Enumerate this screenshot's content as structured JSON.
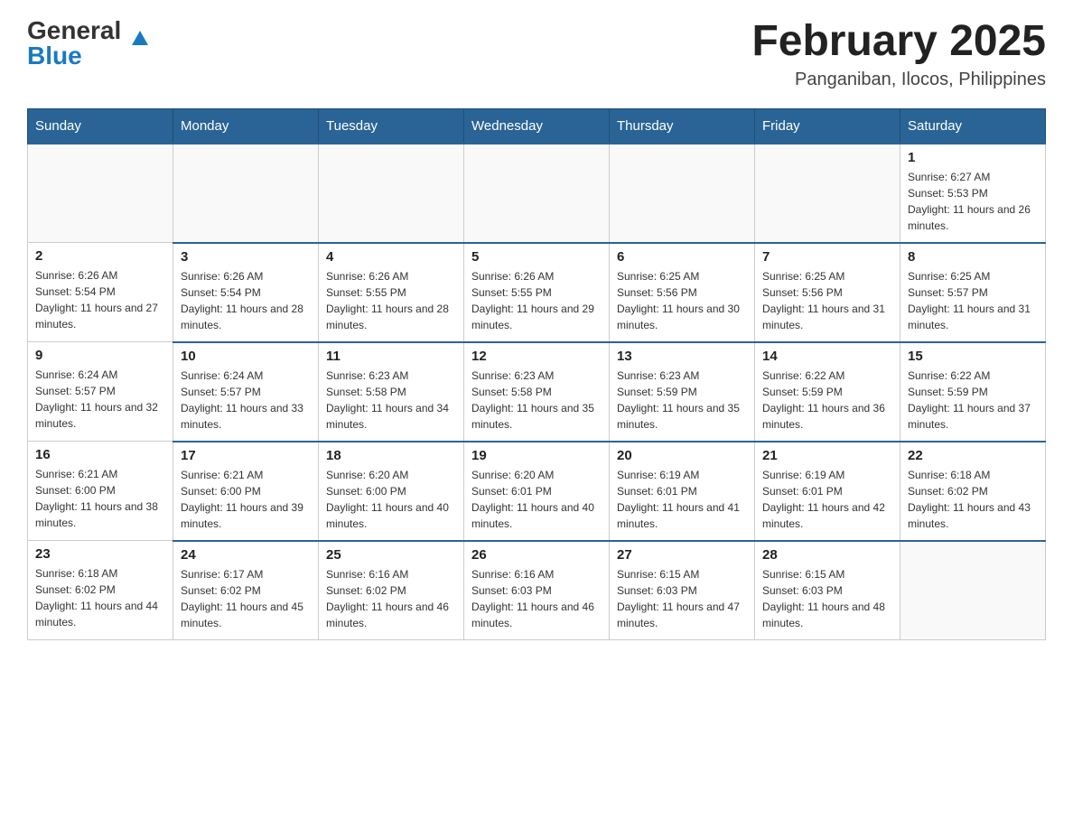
{
  "header": {
    "logo": {
      "general": "General",
      "blue": "Blue",
      "arrow": "▲"
    },
    "title": "February 2025",
    "location": "Panganiban, Ilocos, Philippines"
  },
  "days_of_week": [
    "Sunday",
    "Monday",
    "Tuesday",
    "Wednesday",
    "Thursday",
    "Friday",
    "Saturday"
  ],
  "weeks": [
    [
      {
        "day": "",
        "info": ""
      },
      {
        "day": "",
        "info": ""
      },
      {
        "day": "",
        "info": ""
      },
      {
        "day": "",
        "info": ""
      },
      {
        "day": "",
        "info": ""
      },
      {
        "day": "",
        "info": ""
      },
      {
        "day": "1",
        "info": "Sunrise: 6:27 AM\nSunset: 5:53 PM\nDaylight: 11 hours and 26 minutes."
      }
    ],
    [
      {
        "day": "2",
        "info": "Sunrise: 6:26 AM\nSunset: 5:54 PM\nDaylight: 11 hours and 27 minutes."
      },
      {
        "day": "3",
        "info": "Sunrise: 6:26 AM\nSunset: 5:54 PM\nDaylight: 11 hours and 28 minutes."
      },
      {
        "day": "4",
        "info": "Sunrise: 6:26 AM\nSunset: 5:55 PM\nDaylight: 11 hours and 28 minutes."
      },
      {
        "day": "5",
        "info": "Sunrise: 6:26 AM\nSunset: 5:55 PM\nDaylight: 11 hours and 29 minutes."
      },
      {
        "day": "6",
        "info": "Sunrise: 6:25 AM\nSunset: 5:56 PM\nDaylight: 11 hours and 30 minutes."
      },
      {
        "day": "7",
        "info": "Sunrise: 6:25 AM\nSunset: 5:56 PM\nDaylight: 11 hours and 31 minutes."
      },
      {
        "day": "8",
        "info": "Sunrise: 6:25 AM\nSunset: 5:57 PM\nDaylight: 11 hours and 31 minutes."
      }
    ],
    [
      {
        "day": "9",
        "info": "Sunrise: 6:24 AM\nSunset: 5:57 PM\nDaylight: 11 hours and 32 minutes."
      },
      {
        "day": "10",
        "info": "Sunrise: 6:24 AM\nSunset: 5:57 PM\nDaylight: 11 hours and 33 minutes."
      },
      {
        "day": "11",
        "info": "Sunrise: 6:23 AM\nSunset: 5:58 PM\nDaylight: 11 hours and 34 minutes."
      },
      {
        "day": "12",
        "info": "Sunrise: 6:23 AM\nSunset: 5:58 PM\nDaylight: 11 hours and 35 minutes."
      },
      {
        "day": "13",
        "info": "Sunrise: 6:23 AM\nSunset: 5:59 PM\nDaylight: 11 hours and 35 minutes."
      },
      {
        "day": "14",
        "info": "Sunrise: 6:22 AM\nSunset: 5:59 PM\nDaylight: 11 hours and 36 minutes."
      },
      {
        "day": "15",
        "info": "Sunrise: 6:22 AM\nSunset: 5:59 PM\nDaylight: 11 hours and 37 minutes."
      }
    ],
    [
      {
        "day": "16",
        "info": "Sunrise: 6:21 AM\nSunset: 6:00 PM\nDaylight: 11 hours and 38 minutes."
      },
      {
        "day": "17",
        "info": "Sunrise: 6:21 AM\nSunset: 6:00 PM\nDaylight: 11 hours and 39 minutes."
      },
      {
        "day": "18",
        "info": "Sunrise: 6:20 AM\nSunset: 6:00 PM\nDaylight: 11 hours and 40 minutes."
      },
      {
        "day": "19",
        "info": "Sunrise: 6:20 AM\nSunset: 6:01 PM\nDaylight: 11 hours and 40 minutes."
      },
      {
        "day": "20",
        "info": "Sunrise: 6:19 AM\nSunset: 6:01 PM\nDaylight: 11 hours and 41 minutes."
      },
      {
        "day": "21",
        "info": "Sunrise: 6:19 AM\nSunset: 6:01 PM\nDaylight: 11 hours and 42 minutes."
      },
      {
        "day": "22",
        "info": "Sunrise: 6:18 AM\nSunset: 6:02 PM\nDaylight: 11 hours and 43 minutes."
      }
    ],
    [
      {
        "day": "23",
        "info": "Sunrise: 6:18 AM\nSunset: 6:02 PM\nDaylight: 11 hours and 44 minutes."
      },
      {
        "day": "24",
        "info": "Sunrise: 6:17 AM\nSunset: 6:02 PM\nDaylight: 11 hours and 45 minutes."
      },
      {
        "day": "25",
        "info": "Sunrise: 6:16 AM\nSunset: 6:02 PM\nDaylight: 11 hours and 46 minutes."
      },
      {
        "day": "26",
        "info": "Sunrise: 6:16 AM\nSunset: 6:03 PM\nDaylight: 11 hours and 46 minutes."
      },
      {
        "day": "27",
        "info": "Sunrise: 6:15 AM\nSunset: 6:03 PM\nDaylight: 11 hours and 47 minutes."
      },
      {
        "day": "28",
        "info": "Sunrise: 6:15 AM\nSunset: 6:03 PM\nDaylight: 11 hours and 48 minutes."
      },
      {
        "day": "",
        "info": ""
      }
    ]
  ],
  "colors": {
    "header_bg": "#2a6496",
    "header_text": "#ffffff",
    "border": "#cccccc",
    "accent": "#1a7abf"
  }
}
